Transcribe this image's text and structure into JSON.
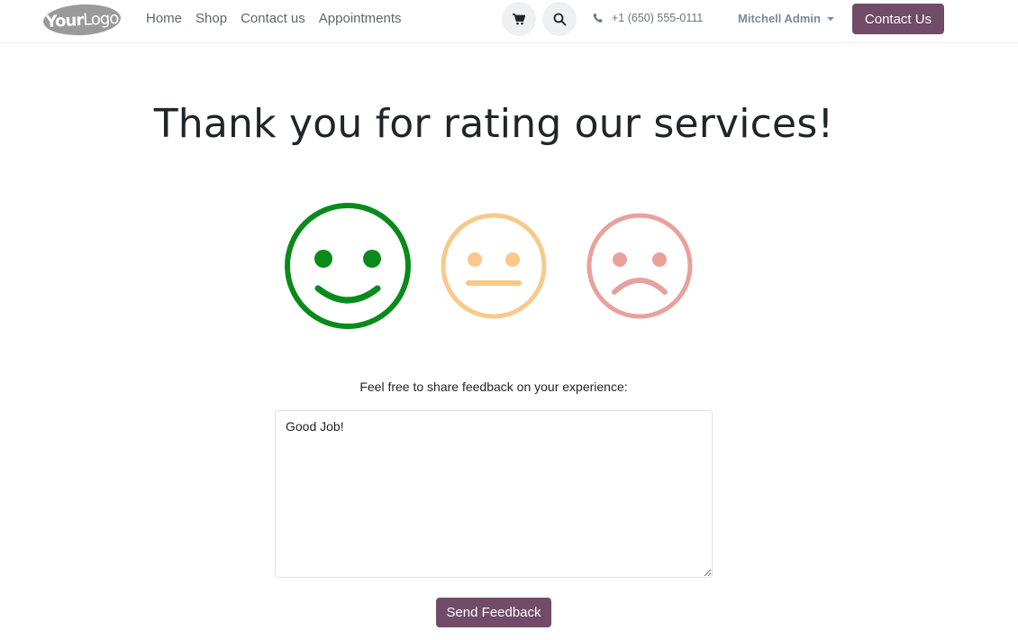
{
  "header": {
    "logo": {
      "bold": "Your",
      "light": "Logo"
    },
    "nav": [
      "Home",
      "Shop",
      "Contact us",
      "Appointments"
    ],
    "phone": "+1 (650) 555-0111",
    "user": "Mitchell Admin",
    "contact_button": "Contact Us",
    "icons": {
      "cart": "cart-icon",
      "search": "search-icon",
      "phone": "phone-icon"
    }
  },
  "main": {
    "title": "Thank you for rating our services!",
    "ratings": [
      {
        "name": "happy",
        "color": "#0a8a1a",
        "selected": true
      },
      {
        "name": "neutral",
        "color": "#f8c98b",
        "selected": false
      },
      {
        "name": "sad",
        "color": "#e8a19c",
        "selected": false
      }
    ],
    "feedback_label": "Feel free to share feedback on your experience:",
    "feedback_value": "Good Job!",
    "send_button": "Send Feedback"
  },
  "colors": {
    "brand": "#714b67"
  }
}
